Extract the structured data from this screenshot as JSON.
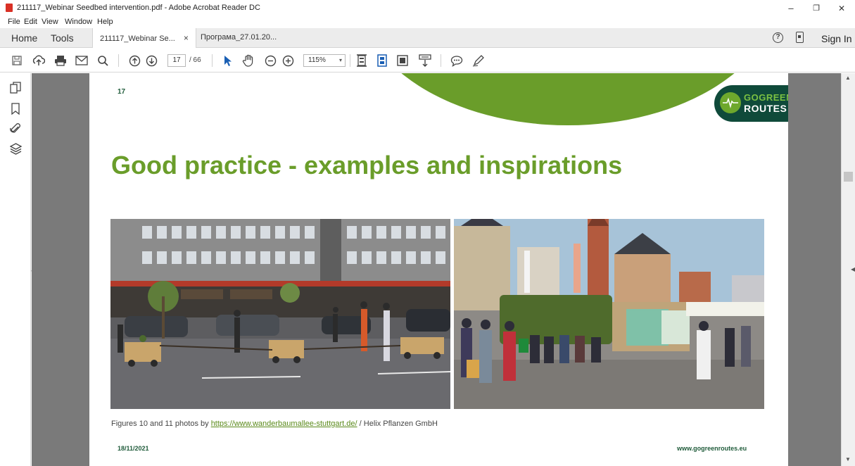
{
  "window": {
    "title": "211117_Webinar Seedbed intervention.pdf - Adobe Acrobat Reader DC",
    "minimize": "–",
    "restore": "❐",
    "close": "✕"
  },
  "menu": {
    "items": [
      "File",
      "Edit",
      "View",
      "Window",
      "Help"
    ]
  },
  "tabs": {
    "home": "Home",
    "tools": "Tools",
    "documents": [
      {
        "label": "211117_Webinar Se...",
        "close": "×",
        "active": true
      },
      {
        "label": "Програма_27.01.20...",
        "active": false
      }
    ],
    "help_icon": "?",
    "sign_in": "Sign In"
  },
  "toolbar": {
    "page_current": "17",
    "page_total": "/ 66",
    "zoom": "115%",
    "zoom_arrow": "▾",
    "icons": [
      "save-icon",
      "upload-icon",
      "print-icon",
      "email-icon",
      "search-icon",
      "page-up-icon",
      "page-down-icon",
      "select-arrow-icon",
      "hand-icon",
      "zoom-out-icon",
      "zoom-in-icon",
      "fit-page-icon",
      "scroll-mode-icon",
      "full-screen-icon",
      "read-mode-icon",
      "comment-icon",
      "sign-pen-icon"
    ]
  },
  "slide": {
    "number": "17",
    "logo_line1": "GOGREEN",
    "logo_line2": "ROUTES",
    "title": "Good practice - examples and inspirations",
    "caption_prefix": "Figures 10 and 11 photos by",
    "caption_link": "https://www.wanderbaumallee-stuttgart.de/",
    "caption_suffix": "/ Helix Pflanzen GmbH",
    "date": "18/11/2021",
    "url": "www.gogreenroutes.eu",
    "accent_color": "#6a9d2a",
    "dark_color": "#0f4a3a"
  },
  "side_panel": {
    "icons": [
      "pages-icon",
      "bookmark-icon",
      "attachment-icon",
      "layers-icon"
    ]
  }
}
